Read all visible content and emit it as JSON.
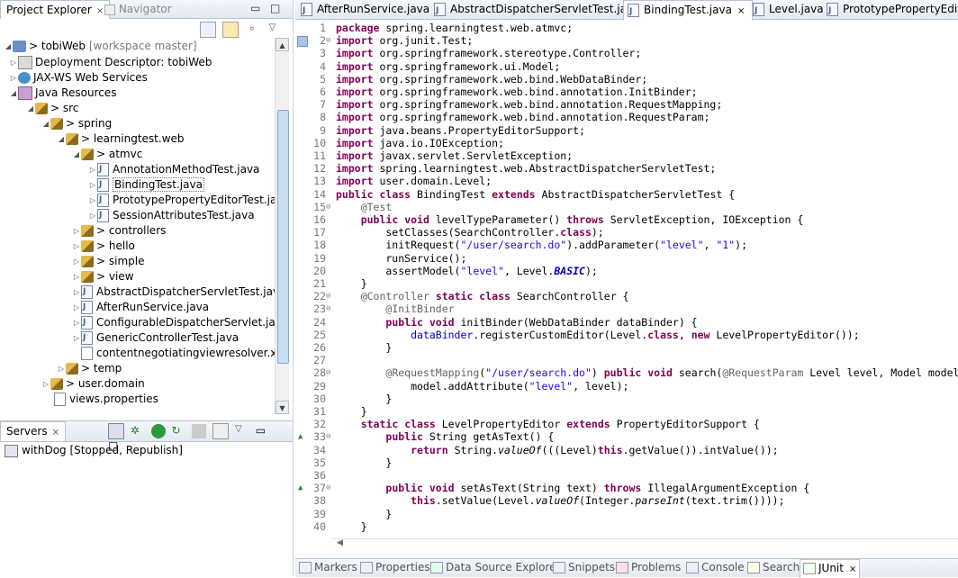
{
  "project_explorer": {
    "tab_label": "Project Explorer",
    "navigator_tab": "Navigator",
    "tree": [
      {
        "label": "tobiWeb",
        "extra": "[workspace master]",
        "prefix": "> "
      },
      {
        "label": "Deployment Descriptor: tobiWeb"
      },
      {
        "label": "JAX-WS Web Services"
      },
      {
        "label": "Java Resources"
      },
      {
        "label": "src",
        "prefix": "> "
      },
      {
        "label": "spring",
        "prefix": "> "
      },
      {
        "label": "learningtest.web",
        "prefix": "> "
      },
      {
        "label": "atmvc",
        "prefix": "> "
      },
      {
        "label": "AnnotationMethodTest.java"
      },
      {
        "label": "BindingTest.java"
      },
      {
        "label": "PrototypePropertyEditorTest.java"
      },
      {
        "label": "SessionAttributesTest.java"
      },
      {
        "label": "controllers",
        "prefix": "> "
      },
      {
        "label": "hello",
        "prefix": "> "
      },
      {
        "label": "simple",
        "prefix": "> "
      },
      {
        "label": "view",
        "prefix": "> "
      },
      {
        "label": "AbstractDispatcherServletTest.java"
      },
      {
        "label": "AfterRunService.java"
      },
      {
        "label": "ConfigurableDispatcherServlet.java"
      },
      {
        "label": "GenericControllerTest.java"
      },
      {
        "label": "contentnegotiatingviewresolver.xml"
      },
      {
        "label": "temp",
        "prefix": "> "
      },
      {
        "label": "user.domain",
        "prefix": "> "
      },
      {
        "label": "views.properties"
      }
    ]
  },
  "servers": {
    "tab_label": "Servers",
    "server_name": "withDog",
    "server_status": "[Stopped, Republish]"
  },
  "editor_tabs": [
    {
      "label": "AfterRunService.java"
    },
    {
      "label": "AbstractDispatcherServletTest.java"
    },
    {
      "label": "BindingTest.java"
    },
    {
      "label": "Level.java"
    },
    {
      "label": "PrototypePropertyEdito"
    }
  ],
  "code_lines": [
    {
      "n": "1",
      "t": "package spring.learningtest.web.atmvc;"
    },
    {
      "n": "2",
      "t": "import org.junit.Test;"
    },
    {
      "n": "3",
      "t": "import org.springframework.stereotype.Controller;"
    },
    {
      "n": "4",
      "t": "import org.springframework.ui.Model;"
    },
    {
      "n": "5",
      "t": "import org.springframework.web.bind.WebDataBinder;"
    },
    {
      "n": "6",
      "t": "import org.springframework.web.bind.annotation.InitBinder;"
    },
    {
      "n": "7",
      "t": "import org.springframework.web.bind.annotation.RequestMapping;"
    },
    {
      "n": "8",
      "t": "import org.springframework.web.bind.annotation.RequestParam;"
    },
    {
      "n": "9",
      "t": "import java.beans.PropertyEditorSupport;"
    },
    {
      "n": "10",
      "t": "import java.io.IOException;"
    },
    {
      "n": "11",
      "t": "import javax.servlet.ServletException;"
    },
    {
      "n": "12",
      "t": "import spring.learningtest.web.AbstractDispatcherServletTest;"
    },
    {
      "n": "13",
      "t": "import user.domain.Level;"
    },
    {
      "n": "14",
      "t": "public class BindingTest extends AbstractDispatcherServletTest {"
    },
    {
      "n": "15",
      "t": "    @Test"
    },
    {
      "n": "16",
      "t": "    public void levelTypeParameter() throws ServletException, IOException {"
    },
    {
      "n": "17",
      "t": "        setClasses(SearchController.class);"
    },
    {
      "n": "18",
      "t": "        initRequest(\"/user/search.do\").addParameter(\"level\", \"1\");"
    },
    {
      "n": "19",
      "t": "        runService();"
    },
    {
      "n": "20",
      "t": "        assertModel(\"level\", Level.BASIC);"
    },
    {
      "n": "21",
      "t": "    }"
    },
    {
      "n": "22",
      "t": "    @Controller static class SearchController {"
    },
    {
      "n": "23",
      "t": "        @InitBinder"
    },
    {
      "n": "24",
      "t": "        public void initBinder(WebDataBinder dataBinder) {"
    },
    {
      "n": "25",
      "t": "            dataBinder.registerCustomEditor(Level.class, new LevelPropertyEditor());"
    },
    {
      "n": "26",
      "t": "        }"
    },
    {
      "n": "27",
      "t": ""
    },
    {
      "n": "28",
      "t": "        @RequestMapping(\"/user/search.do\") public void search(@RequestParam Level level, Model model) {"
    },
    {
      "n": "29",
      "t": "            model.addAttribute(\"level\", level);"
    },
    {
      "n": "30",
      "t": "        }"
    },
    {
      "n": "31",
      "t": "    }"
    },
    {
      "n": "32",
      "t": "    static class LevelPropertyEditor extends PropertyEditorSupport {"
    },
    {
      "n": "33",
      "t": "        public String getAsText() {"
    },
    {
      "n": "34",
      "t": "            return String.valueOf(((Level)this.getValue()).intValue());"
    },
    {
      "n": "35",
      "t": "        }"
    },
    {
      "n": "36",
      "t": ""
    },
    {
      "n": "37",
      "t": "        public void setAsText(String text) throws IllegalArgumentException {"
    },
    {
      "n": "38",
      "t": "            this.setValue(Level.valueOf(Integer.parseInt(text.trim())));"
    },
    {
      "n": "39",
      "t": "        }"
    },
    {
      "n": "40",
      "t": "    }"
    }
  ],
  "bottom_tabs": [
    {
      "label": "Markers"
    },
    {
      "label": "Properties"
    },
    {
      "label": "Data Source Explorer"
    },
    {
      "label": "Snippets"
    },
    {
      "label": "Problems"
    },
    {
      "label": "Console"
    },
    {
      "label": "Search"
    },
    {
      "label": "JUnit"
    }
  ],
  "colors": {
    "keyword": "#7f0055",
    "string": "#2a00ff",
    "annotation": "#646464",
    "field": "#0000c0"
  }
}
